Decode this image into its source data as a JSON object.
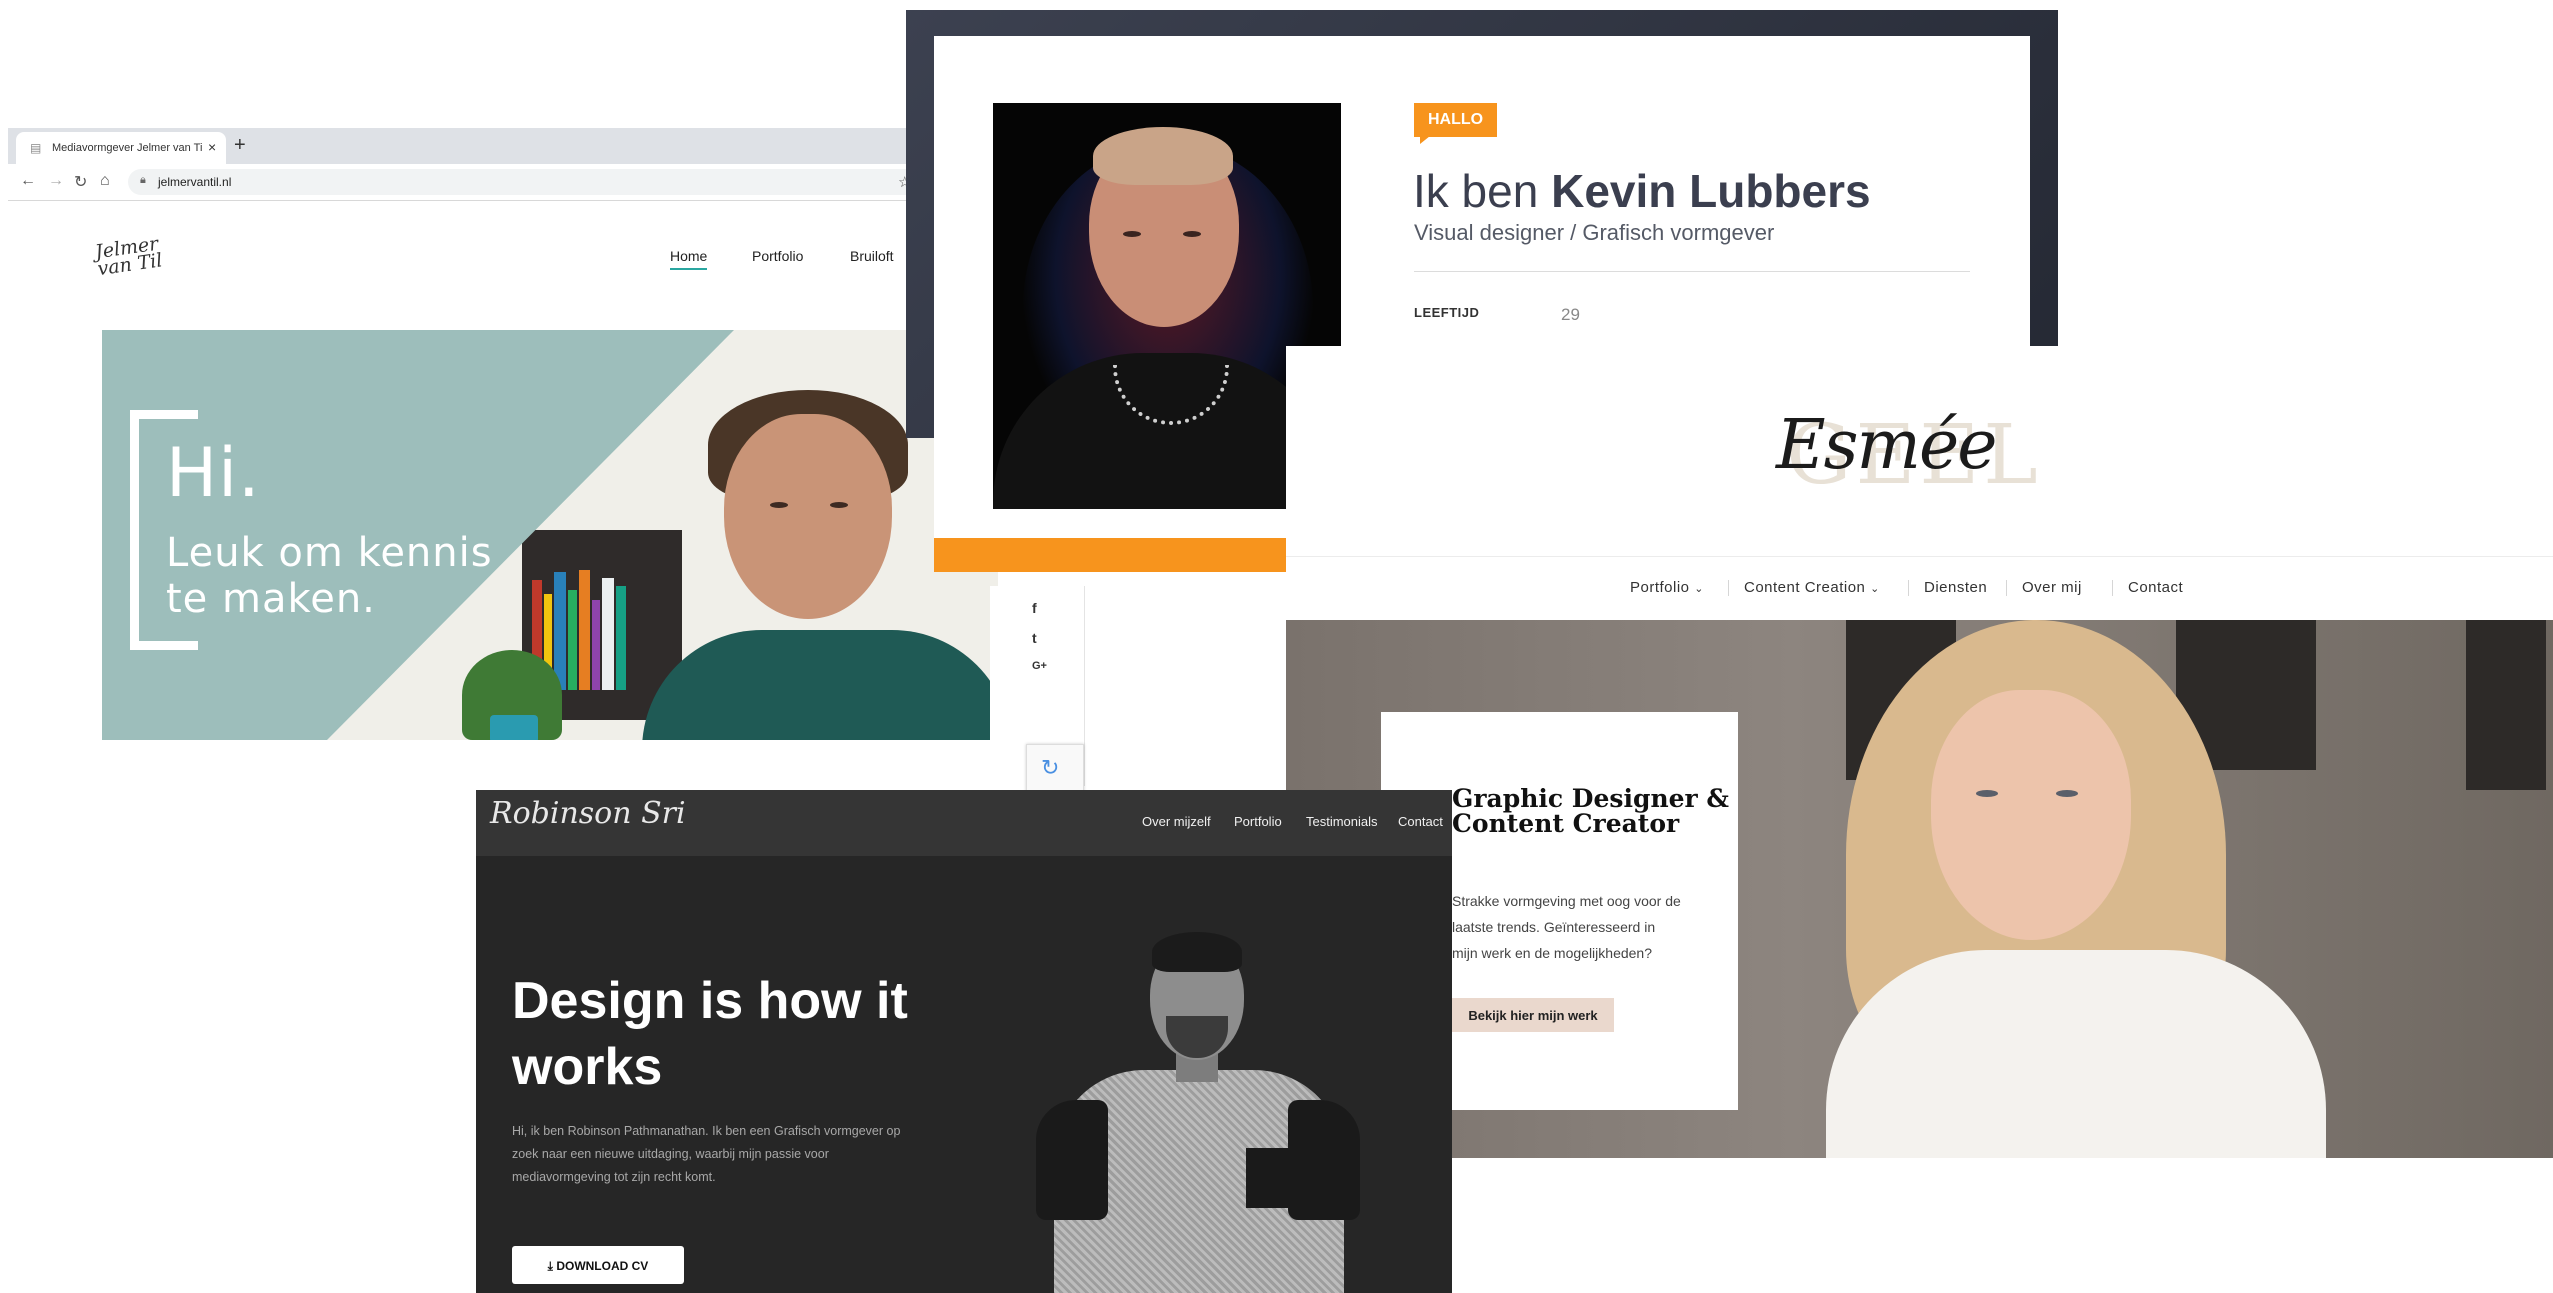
{
  "jelmer": {
    "tab_title": "Mediavormgever Jelmer van Ti",
    "tab_close": "×",
    "new_tab": "+",
    "url": "jelmervantil.nl",
    "logo_line1": "Jelmer",
    "logo_line2": "van Til",
    "nav": [
      "Home",
      "Portfolio",
      "Bruiloft"
    ],
    "hero_hi": "Hi.",
    "hero_line": "Leuk om kennis te maken."
  },
  "kevin": {
    "badge": "HALLO",
    "heading_prefix": "Ik ben ",
    "heading_name": "Kevin Lubbers",
    "subtitle": "Visual designer / Grafisch vormgever",
    "age_label": "LEEFTIJD",
    "age_value": "29",
    "accent_color": "#f7941d"
  },
  "social": {
    "icons": [
      "facebook-icon",
      "twitter-icon",
      "google-plus-icon"
    ],
    "glyphs": [
      "f",
      "t",
      "G+"
    ]
  },
  "esmee": {
    "logo_bg": "GEEL",
    "logo_script": "Esmée",
    "nav": [
      "Portfolio",
      "Content Creation",
      "Diensten",
      "Over mij",
      "Contact"
    ],
    "nav_dropdown_glyph": "⌄",
    "title": "Graphic Designer & Content Creator",
    "text": "Strakke vormgeving met oog voor de laatste trends. Geïnteresseerd in mijn werk en de mogelijkheden?",
    "button": "Bekijk hier mijn werk"
  },
  "robinson": {
    "logo": "Robinson Sri",
    "nav": [
      "Over mijzelf",
      "Portfolio",
      "Testimonials",
      "Contact"
    ],
    "headline": "Design is how it works",
    "paragraph": "Hi, ik ben Robinson Pathmanathan. Ik ben een Grafisch vormgever op zoek naar een nieuwe uitdaging, waarbij mijn passie voor mediavormgeving tot zijn recht komt.",
    "button": "DOWNLOAD CV"
  }
}
